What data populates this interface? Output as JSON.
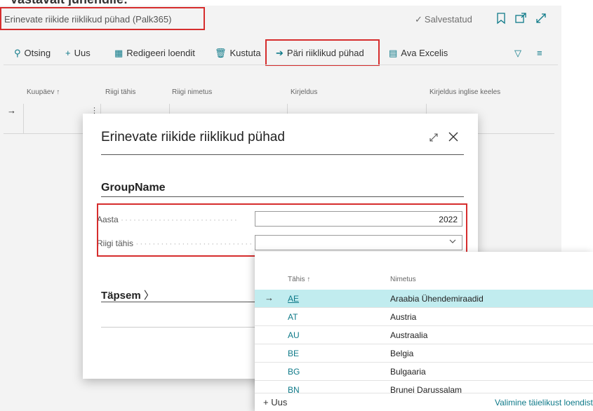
{
  "page": {
    "title": "Erinevate riikide riiklikud pühad (Palk365)",
    "status": "Salvestatud"
  },
  "toolbar": {
    "search": "Otsing",
    "new": "Uus",
    "edit_list": "Redigeeri loendit",
    "delete": "Kustuta",
    "get_holidays": "Päri riiklikud pühad",
    "open_excel": "Ava Excelis"
  },
  "grid": {
    "headers": [
      "Kuupäev ↑",
      "Riigi tähis",
      "Riigi nimetus",
      "Kirjeldus",
      "Kirjeldus inglise keeles"
    ]
  },
  "dialog": {
    "title": "Erinevate riikide riiklikud pühad",
    "group": "GroupName",
    "fields": {
      "year_label": "Aasta",
      "year_value": "2022",
      "country_label": "Riigi tähis",
      "country_value": ""
    },
    "more": "Täpsem"
  },
  "lookup": {
    "headers": {
      "code": "Tähis ↑",
      "name": "Nimetus"
    },
    "rows": [
      {
        "code": "AE",
        "name": "Araabia Ühendemiraadid"
      },
      {
        "code": "AT",
        "name": "Austria"
      },
      {
        "code": "AU",
        "name": "Austraalia"
      },
      {
        "code": "BE",
        "name": "Belgia"
      },
      {
        "code": "BG",
        "name": "Bulgaaria"
      },
      {
        "code": "BN",
        "name": "Brunei Darussalam"
      }
    ],
    "new_label": "Uus",
    "full_list_link": "Valimine täielikust loendist"
  },
  "colors": {
    "accent": "#0f7a89",
    "highlight": "#d62d2d",
    "selected_row": "#c1ecef"
  }
}
